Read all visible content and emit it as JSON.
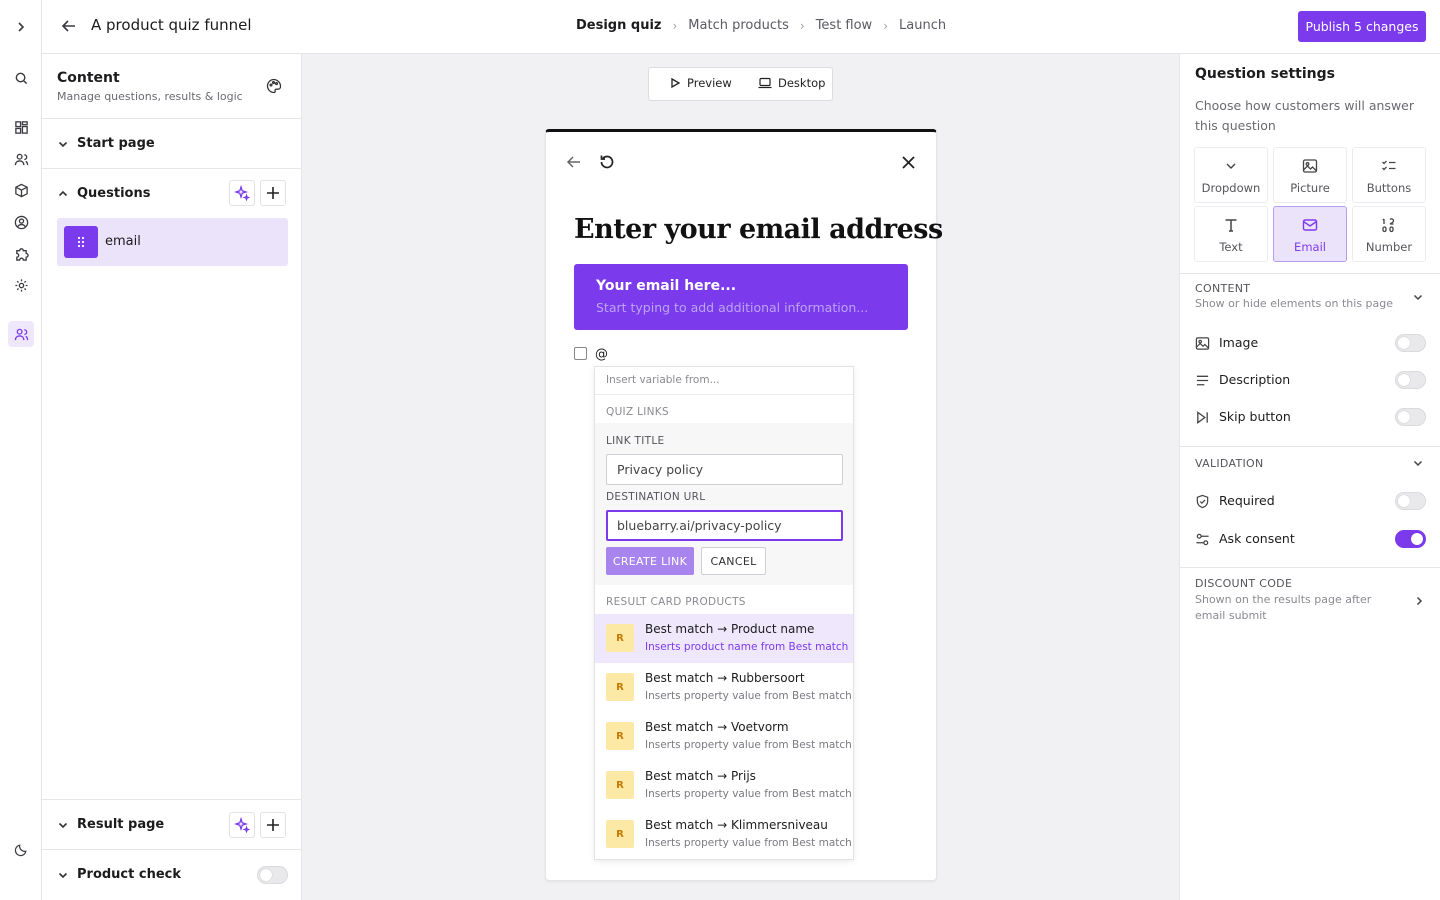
{
  "topbar": {
    "title": "A product quiz funnel",
    "steps": [
      "Design quiz",
      "Match products",
      "Test flow",
      "Launch"
    ],
    "publish_label": "Publish 5 changes"
  },
  "left": {
    "title": "Content",
    "subtitle": "Manage questions, results & logic",
    "start_page": "Start page",
    "questions": "Questions",
    "question_items": [
      "email"
    ],
    "result_page": "Result page",
    "product_check": "Product check",
    "product_check_on": false
  },
  "preview": {
    "preview_label": "Preview",
    "device_label": "Desktop",
    "question_title": "Enter your email address",
    "email_placeholder": "Your email here...",
    "email_description": "Start typing to add additional information...",
    "consent_text": "@"
  },
  "dropdown": {
    "search_placeholder": "Insert variable from...",
    "quiz_links_header": "QUIZ LINKS",
    "link_title_label": "LINK TITLE",
    "link_title_value": "Privacy policy",
    "destination_label": "DESTINATION URL",
    "destination_value": "bluebarry.ai/privacy-policy",
    "create_label": "CREATE LINK",
    "cancel_label": "CANCEL",
    "result_header": "RESULT CARD PRODUCTS",
    "badge": "R",
    "items": [
      {
        "title": "Best match → Product name",
        "sub": "Inserts product name from Best match"
      },
      {
        "title": "Best match → Rubbersoort",
        "sub": "Inserts property value from Best match"
      },
      {
        "title": "Best match → Voetvorm",
        "sub": "Inserts property value from Best match"
      },
      {
        "title": "Best match → Prijs",
        "sub": "Inserts property value from Best match"
      },
      {
        "title": "Best match → Klimmersniveau",
        "sub": "Inserts property value from Best match"
      }
    ]
  },
  "settings": {
    "title": "Question settings",
    "description": "Choose how customers will answer this question",
    "types": [
      "Dropdown",
      "Picture",
      "Buttons",
      "Text",
      "Email",
      "Number"
    ],
    "selected_type": "Email",
    "content_header": "CONTENT",
    "content_sub": "Show or hide elements on this page",
    "content_toggles": [
      {
        "label": "Image",
        "on": false
      },
      {
        "label": "Description",
        "on": false
      },
      {
        "label": "Skip button",
        "on": false
      }
    ],
    "validation_header": "VALIDATION",
    "validation_toggles": [
      {
        "label": "Required",
        "on": false
      },
      {
        "label": "Ask consent",
        "on": true
      }
    ],
    "discount_header": "DISCOUNT CODE",
    "discount_sub": "Shown on the results page after email submit"
  },
  "colors": {
    "accent": "#7c3aed",
    "accent_light": "#ebe3fa",
    "badge_bg": "#fde9a6"
  }
}
